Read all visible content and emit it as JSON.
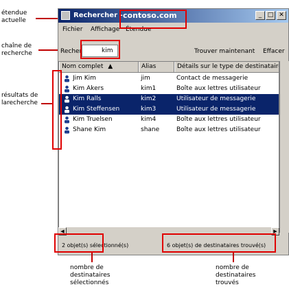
{
  "window": {
    "title": "Rechercher -",
    "scope": "contoso.com",
    "buttons": {
      "minimize": "_",
      "maximize": "□",
      "close": "✕"
    }
  },
  "menu": [
    "Fichier",
    "Affichage",
    "Étendue"
  ],
  "search": {
    "label": "Recherche :",
    "value": "kim",
    "find_button": "Trouver maintenant",
    "clear_button": "Effacer"
  },
  "list": {
    "columns": [
      "Nom complet",
      "Alias",
      "Détails sur le type de destinataire"
    ],
    "rows": [
      {
        "name": "Jim Kim",
        "alias": "jim",
        "type": "Contact de messagerie",
        "icon": "contact-icon",
        "selected": false
      },
      {
        "name": "Kim Akers",
        "alias": "kim1",
        "type": "Boîte aux lettres utilisateur",
        "icon": "mailbox-user-icon",
        "selected": false
      },
      {
        "name": "Kim Ralls",
        "alias": "kim2",
        "type": "Utilisateur de messagerie",
        "icon": "mail-user-icon",
        "selected": true
      },
      {
        "name": "Kim Steffensen",
        "alias": "kim3",
        "type": "Utilisateur de messagerie",
        "icon": "mail-user-icon",
        "selected": true
      },
      {
        "name": "Kim Truelsen",
        "alias": "kim4",
        "type": "Boîte aux lettres utilisateur",
        "icon": "mailbox-user-icon",
        "selected": false
      },
      {
        "name": "Shane Kim",
        "alias": "shane",
        "type": "Boîte aux lettres utilisateur",
        "icon": "mailbox-user-icon",
        "selected": false
      }
    ]
  },
  "status": {
    "selected": "2 objet(s) sélectionné(s)",
    "found": "6 objet(s) de destinataires trouvé(s)"
  },
  "annotations": {
    "scope": [
      "étendue",
      "actuelle"
    ],
    "search_string": [
      "chaîne de",
      "recherche"
    ],
    "results": [
      "résultats de",
      "larecherche"
    ],
    "selected_count": [
      "nombre de",
      "destinataires",
      "sélectionnés"
    ],
    "found_count": [
      "nombre de",
      "destinataires",
      "trouvés"
    ]
  },
  "colors": {
    "highlight": "#e00000",
    "selection": "#0a246a"
  }
}
